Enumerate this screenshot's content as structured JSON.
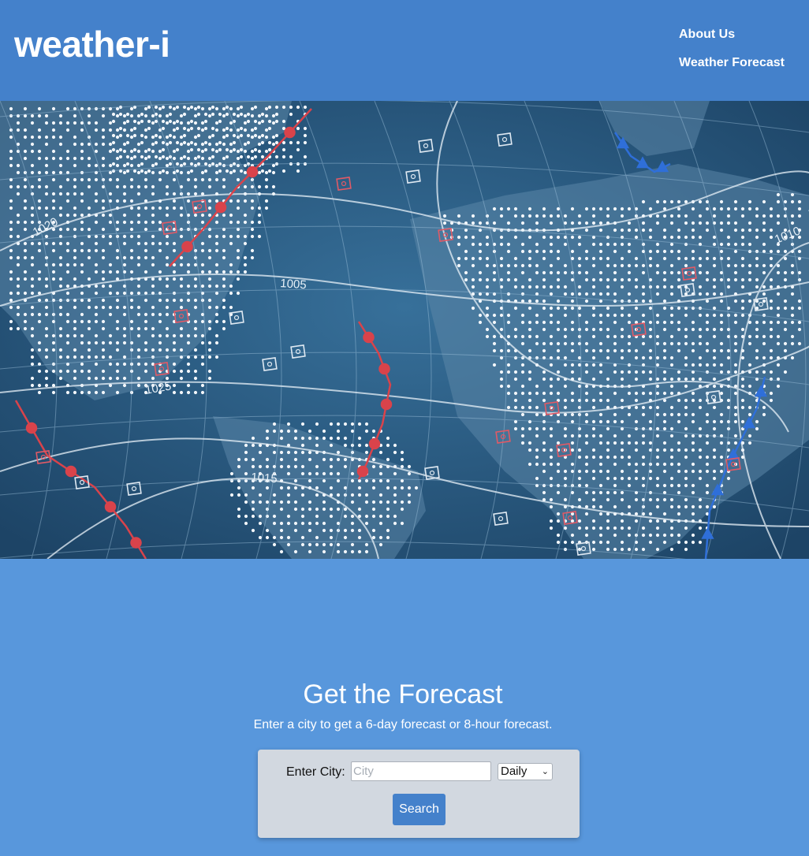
{
  "header": {
    "logo": "weather-i",
    "nav": [
      {
        "label": "About Us"
      },
      {
        "label": "Weather Forecast"
      }
    ]
  },
  "hero": {
    "map_labels": [
      "1020",
      "1005",
      "1025",
      "1015",
      "1010"
    ]
  },
  "forecast": {
    "title": "Get the Forecast",
    "subtitle": "Enter a city to get a 6-day forecast or 8-hour forecast.",
    "city_label": "Enter City:",
    "city_placeholder": "City",
    "city_value": "",
    "mode_selected": "Daily",
    "search_label": "Search"
  },
  "colors": {
    "header_bg": "#4481cb",
    "page_bg": "#5897dc",
    "card_bg": "#d2d8e0",
    "button_bg": "#4481cb",
    "map_bg": "#2b5b82",
    "front_red": "#d9434b",
    "front_blue": "#2f6fd9"
  }
}
